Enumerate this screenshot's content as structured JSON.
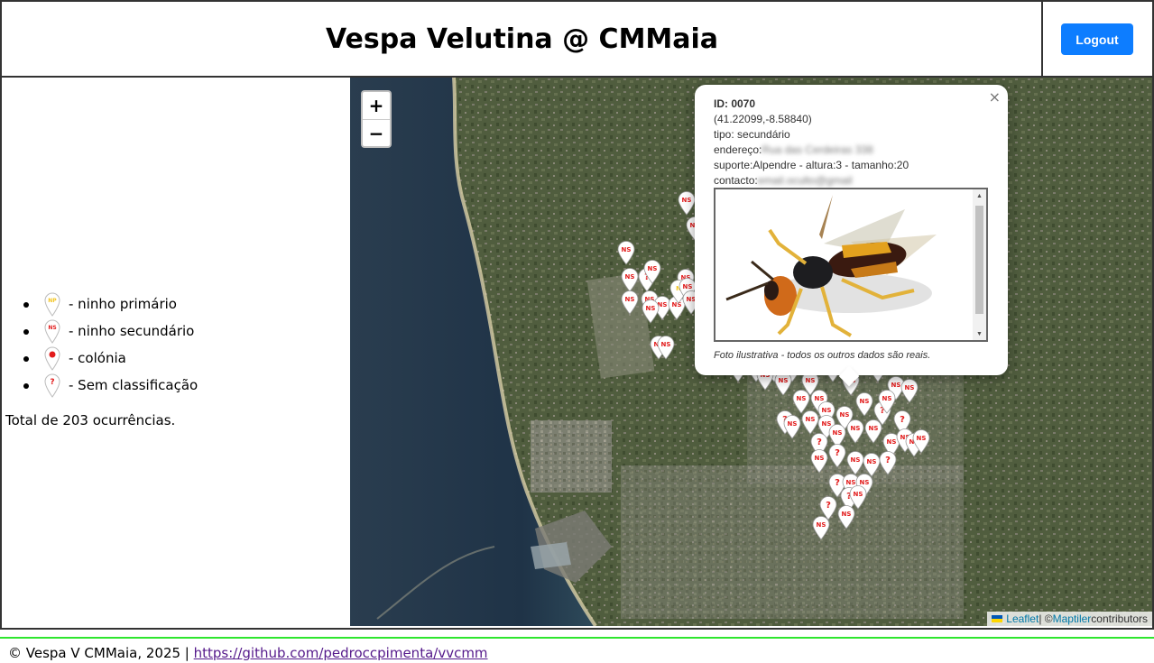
{
  "header": {
    "title": "Vespa Velutina @ CMMaia",
    "logout_label": "Logout"
  },
  "legend": {
    "items": [
      {
        "icon": "np-pin-icon",
        "code": "NP",
        "color": "#f3c623",
        "label": "- ninho primário"
      },
      {
        "icon": "ns-pin-icon",
        "code": "NS",
        "color": "#e21b1b",
        "label": "- ninho secundário"
      },
      {
        "icon": "colony-pin-icon",
        "code": "●",
        "color": "#e21b1b",
        "label": "- colónia"
      },
      {
        "icon": "unknown-pin-icon",
        "code": "?",
        "color": "#e21b1b",
        "label": "- Sem classificação"
      }
    ],
    "total": "Total de 203 ocurrências."
  },
  "map": {
    "zoom_in": "+",
    "zoom_out": "−",
    "popup": {
      "close": "×",
      "id": "ID: 0070",
      "coords": "(41.22099,-8.58840)",
      "tipo": "tipo: secundário",
      "endereco_label": "endereço:",
      "endereco_value": "Rua das Cerdeiras 338",
      "suporte": "suporte:Alpendre - altura:3 - tamanho:20",
      "contacto_label": "contacto:",
      "contacto_value": "email.oculto@gmail",
      "caption": "Foto ilustrativa - todos os outros dados são reais."
    },
    "attribution": {
      "leaflet": "Leaflet",
      "sep": " | © ",
      "maptiler": "Maptiler",
      "contributors": " contributors"
    }
  },
  "footer": {
    "text": "© Vespa V CMMaia, 2025 | ",
    "link": "https://github.com/pedroccpimenta/vvcmm"
  }
}
